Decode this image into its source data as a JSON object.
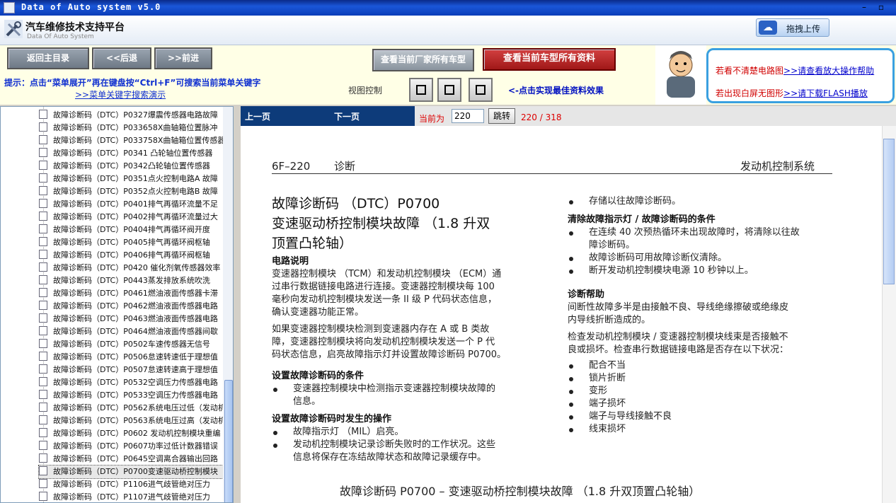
{
  "window": {
    "title": "Data of Auto system v5.0"
  },
  "header": {
    "title": "汽车维修技术支持平台",
    "subtitle": "Data Of Auto System",
    "upload_label": "拖拽上传"
  },
  "nav": {
    "home": "返回主目录",
    "back": "<<后退",
    "forward": ">>前进",
    "all_models": "查看当前厂家所有车型",
    "all_data": "查看当前车型所有资料"
  },
  "hint": {
    "text": "提示：点击“菜单展开”再在键盘按“Ctrl+F”可搜索当前菜单关键字",
    "link": ">>菜单关键字搜索演示"
  },
  "view": {
    "label": "视图控制",
    "tip": "<-点击实现最佳资料效果"
  },
  "help": {
    "line1_text": "若看不清楚电路图",
    "line1_link": ">>请查看放大操作帮助",
    "line2_text": "若出现白屏无图形",
    "line2_link": ">>请下载FLASH播放"
  },
  "docbar": {
    "prev": "上一页",
    "next": "下一页",
    "current_label": "当前为",
    "page_input": "220",
    "go": "跳转",
    "page_info": "220 / 318"
  },
  "tree": {
    "items": [
      "故障诊断码（DTC）P0327爆震传感器电路故障",
      "故障诊断码（DTC）P033658X曲轴箱位置脉冲",
      "故障诊断码（DTC）P033758X曲轴箱位置传感器",
      "故障诊断码（DTC）P0341 凸轮轴位置传感器",
      "故障诊断码（DTC）P0342凸轮轴位置传感器",
      "故障诊断码（DTC）P0351点火控制电路A 故障",
      "故障诊断码（DTC）P0352点火控制电路B 故障",
      "故障诊断码（DTC）P0401排气再循环流量不足",
      "故障诊断码（DTC）P0402排气再循环流量过大",
      "故障诊断码（DTC）P0404排气再循环阀开度",
      "故障诊断码（DTC）P0405排气再循环阀枢轴",
      "故障诊断码（DTC）P0406排气再循环阀枢轴",
      "故障诊断码（DTC）P0420 催化剂氧传感器效率",
      "故障诊断码（DTC）P0443蒸发排放系统吹洗",
      "故障诊断码（DTC）P0461燃油液面传感器卡滞",
      "故障诊断码（DTC）P0462燃油液面传感器电路",
      "故障诊断码（DTC）P0463燃油液面传感器电路",
      "故障诊断码（DTC）P0464燃油液面传感器间歇",
      "故障诊断码（DTC）P0502车速传感器无信号",
      "故障诊断码（DTC）P0506怠速转速低于理想值",
      "故障诊断码（DTC）P0507怠速转速高于理想值",
      "故障诊断码（DTC）P0532空调压力传感器电路",
      "故障诊断码（DTC）P0533空调压力传感器电路",
      "故障诊断码（DTC）P0562系统电压过低（发动机",
      "故障诊断码（DTC）P0563系统电压过高（发动机",
      "故障诊断码（DTC）P0602 发动机控制模块重编",
      "故障诊断码（DTC）P0607功率过低计数器错误",
      "故障诊断码（DTC）P0645空调离合器输出回路",
      "故障诊断码（DTC）P0700变速驱动桥控制模块",
      "故障诊断码（DTC）P1106进气歧管绝对压力",
      "故障诊断码（DTC）P1107进气歧管绝对压力"
    ],
    "selected_index": 28
  },
  "doc": {
    "page_code": "6F–220",
    "section": "诊断",
    "system": "发动机控制系统",
    "title_lines": [
      "故障诊断码 （DTC）P0700",
      "变速驱动桥控制模块故障 （1.8 升双",
      "顶置凸轮轴）"
    ],
    "circuit_heading": "电路说明",
    "circuit_text": [
      "变速器控制模块 （TCM）和发动机控制模块 （ECM）通",
      "过串行数据链接电路进行连接。变速器控制模块每 100",
      "毫秒向发动机控制模块发送一条 II 级 P 代码状态信息，",
      "确认变速器功能正常。"
    ],
    "circuit_text2": [
      "如果变速器控制模块检测到变速器内存在 A 或 B 类故",
      "障，变速器控制模块将向发动机控制模块发送一个 P 代",
      "码状态信息，启亮故障指示灯并设置故障诊断码 P0700。"
    ],
    "cond_heading": "设置故障诊断码的条件",
    "cond_bullet": [
      "变速器控制模块中检测指示变速器控制模块故障的",
      "信息。"
    ],
    "action_heading": "设置故障诊断码时发生的操作",
    "action_b1": "故障指示灯 （MIL）启亮。",
    "action_b2": [
      "发动机控制模块记录诊断失败时的工作状况。这些",
      "信息将保存在冻结故障状态和故障记录缓存中。"
    ],
    "right_b0": "存储以往故障诊断码。",
    "clear_heading": "清除故障指示灯 / 故障诊断码的条件",
    "clear_b1": [
      "在连续 40 次预热循环未出现故障时，将清除以往故",
      "障诊断码。"
    ],
    "clear_b2": "故障诊断码可用故障诊断仪清除。",
    "clear_b3": "断开发动机控制模块电源 10 秒钟以上。",
    "help_heading": "诊断帮助",
    "help_text": [
      "间断性故障多半是由接触不良、导线绝缘擦破或绝缘皮",
      "内导线折断造成的。"
    ],
    "help_text2": [
      "检查发动机控制模块 / 变速器控制模块线束是否接触不",
      "良或损坏。检查串行数据链接电路是否存在以下状况："
    ],
    "help_bullets": [
      "配合不当",
      "锁片折断",
      "变形",
      "端子损坏",
      "端子与导线接触不良",
      "线束损坏"
    ],
    "bottom_title": "故障诊断码 P0700 – 变速驱动桥控制模块故障 （1.8 升双顶置凸轮轴）"
  }
}
